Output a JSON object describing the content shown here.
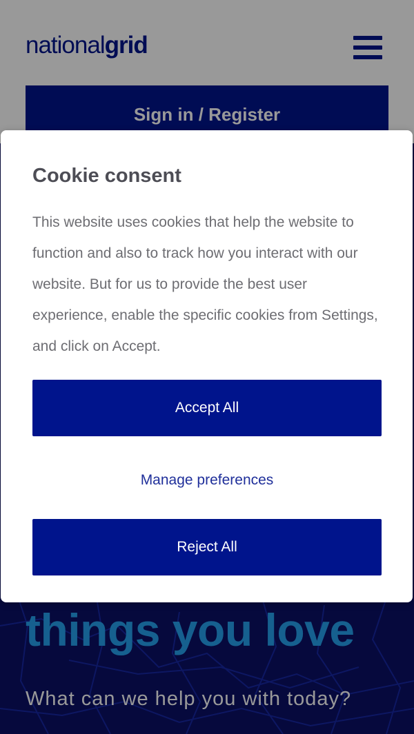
{
  "header": {
    "logo_light": "national",
    "logo_bold": "grid",
    "menu_icon": "hamburger-menu-icon"
  },
  "account": {
    "signin_label": "Sign in / Register"
  },
  "hero": {
    "headline": "things you love",
    "subheading": "What can we help you with today?"
  },
  "cookie_dialog": {
    "title": "Cookie consent",
    "body": "This website uses cookies that help the website to function and also to track how you interact with our website. But for us to provide the best user experience, enable the specific cookies from Settings, and click on Accept.",
    "accept_label": "Accept All",
    "manage_label": "Manage preferences",
    "reject_label": "Reject All"
  },
  "colors": {
    "brand_blue": "#00148c",
    "hero_background": "#0b0f66",
    "hero_accent": "#25a0ee",
    "overlay": "rgba(0,0,0,0.4)"
  }
}
